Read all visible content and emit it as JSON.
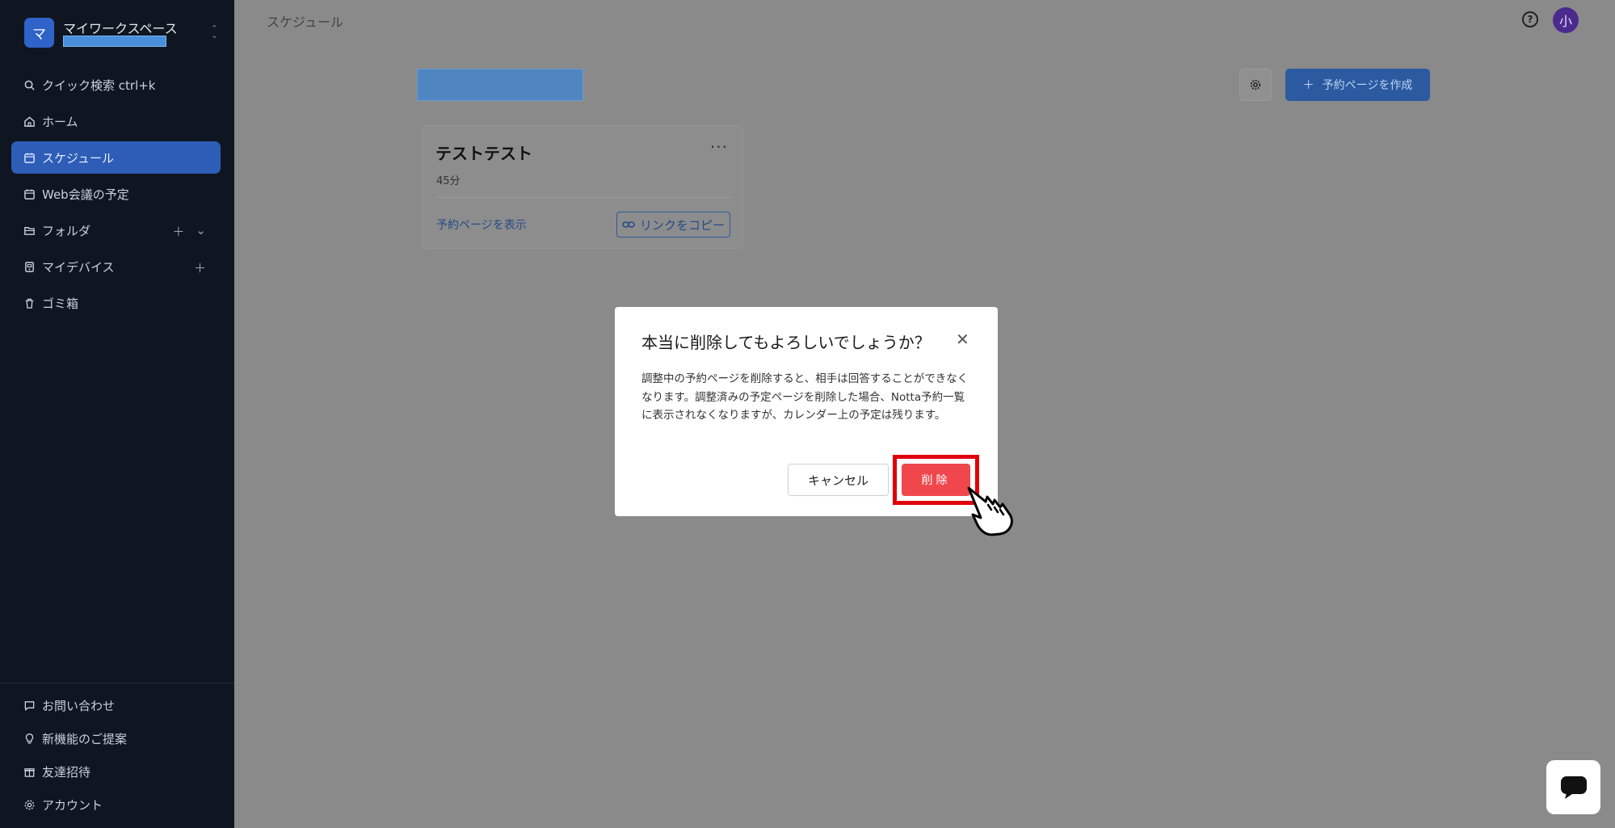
{
  "workspace": {
    "logo_letter": "マ",
    "name": "マイワークスペース"
  },
  "sidebar": {
    "quick_search": "クイック検索 ctrl+k",
    "items": [
      {
        "label": "ホーム",
        "icon": "home-icon"
      },
      {
        "label": "スケジュール",
        "icon": "calendar-icon",
        "active": true
      },
      {
        "label": "Web会議の予定",
        "icon": "calendar-icon"
      },
      {
        "label": "フォルダ",
        "icon": "folder-icon"
      },
      {
        "label": "マイデバイス",
        "icon": "device-icon"
      },
      {
        "label": "ゴミ箱",
        "icon": "trash-icon"
      }
    ],
    "bottom": [
      {
        "label": "お問い合わせ",
        "icon": "message-icon"
      },
      {
        "label": "新機能のご提案",
        "icon": "lightbulb-icon"
      },
      {
        "label": "友達招待",
        "icon": "gift-icon"
      },
      {
        "label": "アカウント",
        "icon": "gear-icon"
      }
    ]
  },
  "header": {
    "title": "スケジュール",
    "avatar": "小"
  },
  "toolbar": {
    "create_label": "予約ページを作成"
  },
  "card": {
    "title": "テストテスト",
    "duration": "45分",
    "view_link": "予約ページを表示",
    "copy_label": "リンクをコピー"
  },
  "dialog": {
    "title": "本当に削除してもよろしいでしょうか？",
    "body": "調整中の予約ページを削除すると、相手は回答することができなくなります。調整済みの予定ページを削除した場合、Notta予約一覧に表示されなくなりますが、カレンダー上の予定は残ります。",
    "cancel_label": "キャンセル",
    "delete_label": "削除"
  },
  "colors": {
    "sidebar_bg": "#0f1621",
    "active": "#2d5db7",
    "delete": "#f0474d",
    "highlight": "#e0000c"
  }
}
